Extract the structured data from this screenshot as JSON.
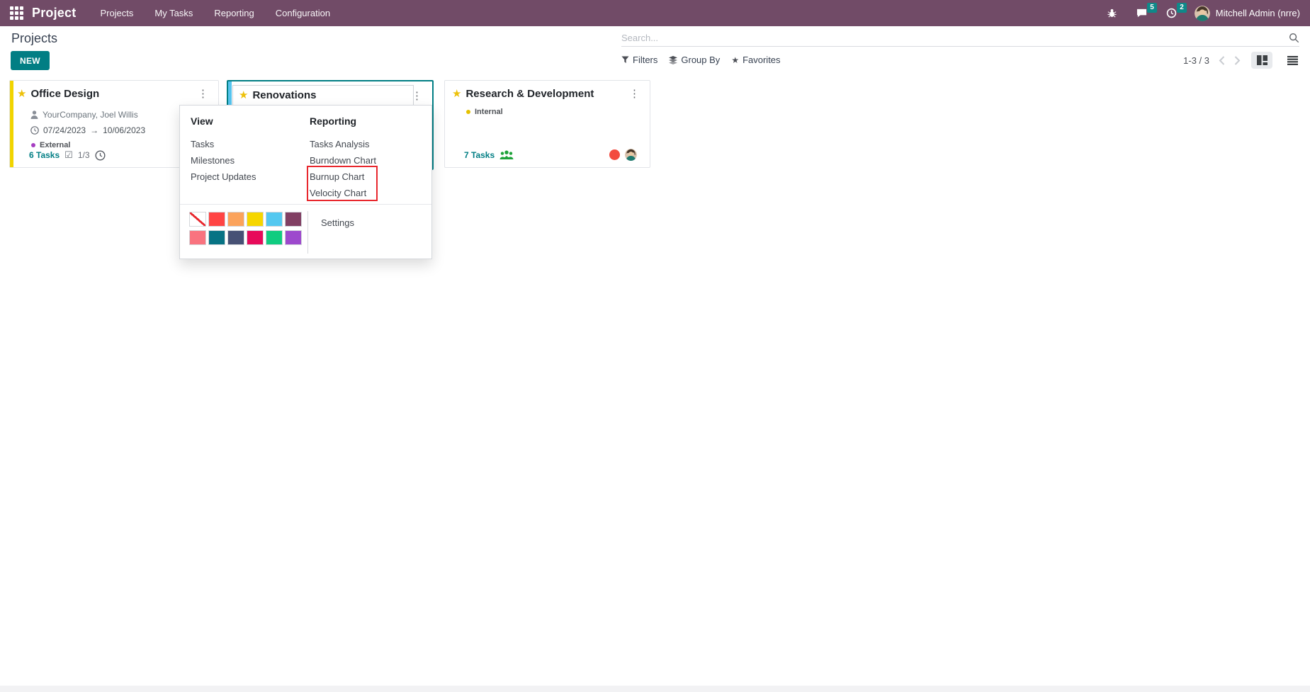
{
  "nav": {
    "app": "Project",
    "menus": [
      "Projects",
      "My Tasks",
      "Reporting",
      "Configuration"
    ],
    "message_badge": "5",
    "activity_badge": "2",
    "user_name": "Mitchell Admin (nrre)"
  },
  "control": {
    "breadcrumb": "Projects",
    "new_label": "NEW",
    "search_placeholder": "Search...",
    "filters_label": "Filters",
    "group_by_label": "Group By",
    "favorites_label": "Favorites",
    "pager": "1-3 / 3"
  },
  "cards": {
    "office": {
      "title": "Office Design",
      "partner": "YourCompany, Joel Willis",
      "date_start": "07/24/2023",
      "date_end": "10/06/2023",
      "tag": "External",
      "tag_color": "#a63ec2",
      "tasks": "6 Tasks",
      "checklist": "1/3",
      "accent": "#f1d400"
    },
    "renovations": {
      "title": "Renovations",
      "accent": "#56c4ee"
    },
    "rnd": {
      "title": "Research & Development",
      "tag": "Internal",
      "tag_color": "#e5c100",
      "tasks": "7 Tasks",
      "status_color": "#f34a3f"
    }
  },
  "menu": {
    "view_header": "View",
    "view_items": [
      "Tasks",
      "Milestones",
      "Project Updates"
    ],
    "reporting_header": "Reporting",
    "reporting_items": [
      "Tasks Analysis",
      "Burndown Chart",
      "Burnup Chart",
      "Velocity Chart"
    ],
    "settings_label": "Settings",
    "colors": [
      "#ffffff",
      "#ff4444",
      "#fba35c",
      "#f6d600",
      "#54c8f0",
      "#813f63",
      "#f9737f",
      "#077384",
      "#475175",
      "#e70a5a",
      "#10cc80",
      "#9d49cd"
    ],
    "highlight_color": "#e8272d"
  },
  "icons": {
    "kebab": "⋮",
    "star": "★",
    "arrow_right": "→",
    "checkbox": "☑"
  },
  "theme": {
    "navbar_bg": "#714b67",
    "primary": "#017e84",
    "badge_bg": "#0f8989",
    "star_color": "#edc10a",
    "selected_border": "#017e84"
  }
}
